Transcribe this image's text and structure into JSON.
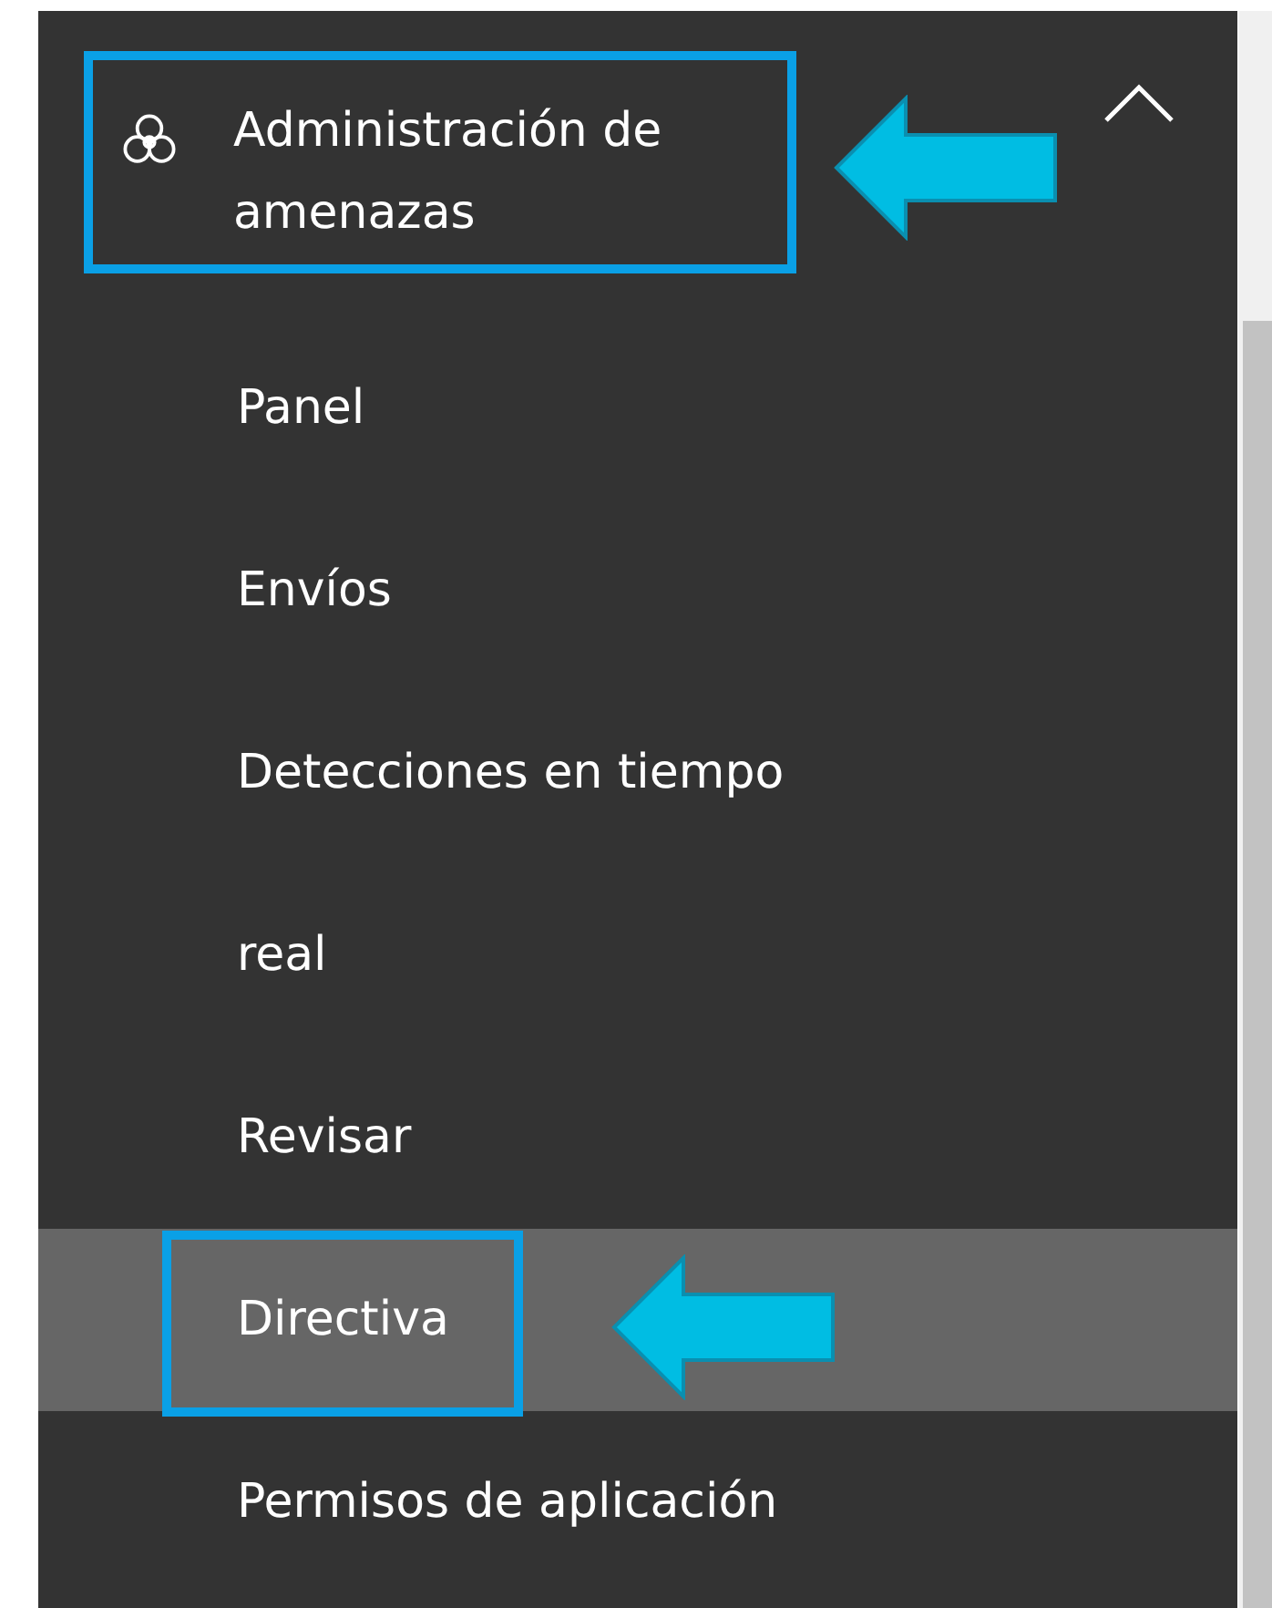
{
  "nav": {
    "group": {
      "label": "Administración de amenazas",
      "expanded": true
    },
    "items": [
      {
        "label": "Panel",
        "selected": false
      },
      {
        "label": "Envíos",
        "selected": false
      },
      {
        "label": "Detecciones en tiempo",
        "selected": false
      },
      {
        "label": "real",
        "selected": false
      },
      {
        "label": "Revisar",
        "selected": false
      },
      {
        "label": "Directiva",
        "selected": true
      },
      {
        "label": "Permisos de aplicación",
        "selected": false
      }
    ]
  }
}
